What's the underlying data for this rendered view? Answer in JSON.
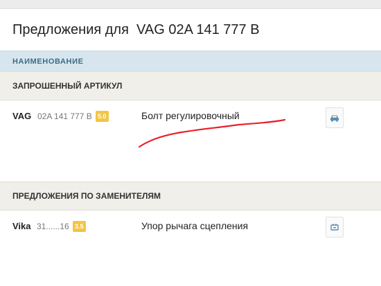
{
  "page": {
    "title": "Предложения для  VAG 02A 141 777 B"
  },
  "table": {
    "column_header": "НАИМЕНОВАНИЕ"
  },
  "requested": {
    "section_label": "ЗАПРОШЕННЫЙ АРТИКУЛ",
    "item": {
      "brand": "VAG",
      "article": "02A 141 777 B",
      "rating": "5.0",
      "description": "Болт регулировочный",
      "icon": "car-icon"
    }
  },
  "replacements": {
    "section_label": "ПРЕДЛОЖЕНИЯ ПО ЗАМЕНИТЕЛЯМ",
    "items": [
      {
        "brand": "Vika",
        "article": "31......16",
        "rating": "3.5",
        "description": "Упор рычага сцепления",
        "icon": "part-icon"
      }
    ]
  },
  "colors": {
    "rating_badge": "#f3c546",
    "header_bg": "#d7e6ee",
    "section_bg": "#f1efea",
    "annotation": "#e8202a",
    "icon_color": "#5b8db1"
  }
}
